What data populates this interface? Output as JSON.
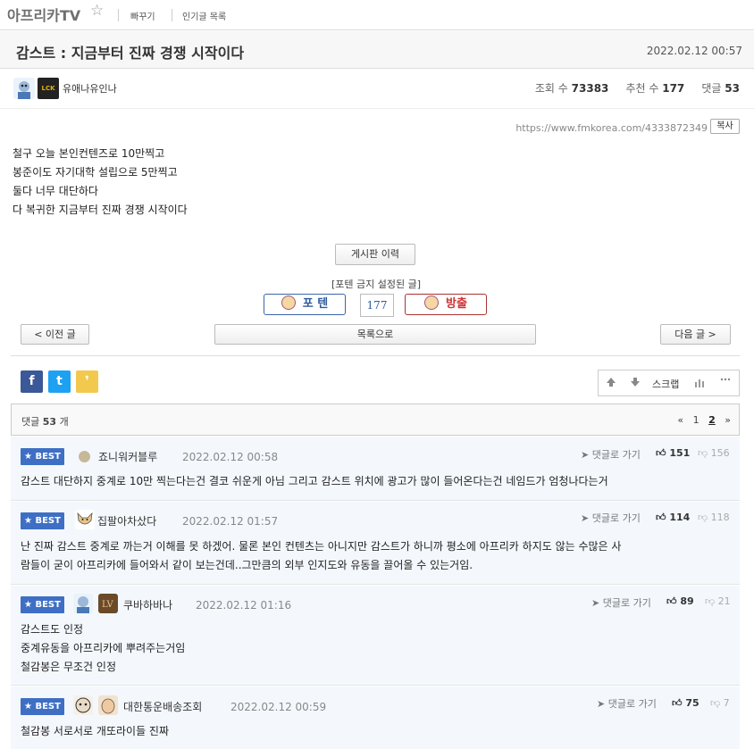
{
  "header": {
    "board_name": "아프리카TV",
    "star": "☆",
    "links": [
      "빠꾸기",
      "인기글 목록"
    ]
  },
  "post": {
    "title": "감스트 : 지금부터 진짜 경쟁 시작이다",
    "date": "2022.02.12 00:57",
    "author": "유애나유인나",
    "author_badge": "LCK",
    "views_label": "조회 수",
    "views": "73383",
    "likes_label": "추천 수",
    "likes": "177",
    "comments_label": "댓글",
    "comments": "53",
    "url": "https://www.fmkorea.com/4333872349",
    "copy_label": "복사",
    "body": [
      "철구 오늘 본인컨텐즈로 10만찍고",
      "봉준이도 자기대학 설립으로 5만찍고",
      "둘다 너무 대단하다",
      "다 복귀한 지금부터 진짜 경쟁 시작이다"
    ]
  },
  "actions": {
    "history_label": "게시판 이력",
    "poten_caption": "[포텐 금지 설정된 글]",
    "poten_label": "포 텐",
    "poten_count": "177",
    "bang_label": "방출",
    "prev_label": "< 이전 글",
    "list_label": "목록으로",
    "next_label": "다음 글 >"
  },
  "share": {
    "facebook": "f",
    "twitter": "t",
    "kakao": "❜",
    "scrap_label": "스크랩"
  },
  "comments_bar": {
    "label": "댓글",
    "count": "53",
    "unit": "개",
    "pager_prev": "«",
    "page1": "1",
    "page2": "2",
    "pager_next": "»"
  },
  "comments": [
    {
      "best": "★ BEST",
      "name": "죠니워커블루",
      "date": "2022.02.12 00:58",
      "reply": "댓글로 가기",
      "up": "151",
      "down": "156",
      "text": [
        "감스트 대단하지 중계로 10만 찍는다는건 결코 쉬운게 아님 그리고 감스트 위치에 광고가 많이 들어온다는건 네임드가 엄청나다는거"
      ]
    },
    {
      "best": "★ BEST",
      "name": "집팔아차샀다",
      "date": "2022.02.12 01:57",
      "reply": "댓글로 가기",
      "up": "114",
      "down": "118",
      "text": [
        "난 진짜 감스트 중계로 까는거 이해를 못 하겠어. 물론 본인 컨텐츠는 아니지만 감스트가 하니까 평소에 아프리카 하지도 않는 수많은 사",
        "람들이 굳이 아프리카에 들어와서 같이 보는건데..그만큼의 외부 인지도와 유동을 끌어올 수 있는거임."
      ]
    },
    {
      "best": "★ BEST",
      "name": "쿠바하바나",
      "date": "2022.02.12 01:16",
      "reply": "댓글로 가기",
      "up": "89",
      "down": "21",
      "text": [
        "감스트도 인정",
        "중계유동을 아프리카에 뿌려주는거임",
        "철감봉은 무조건 인정"
      ]
    },
    {
      "best": "★ BEST",
      "name": "대한통운배송조회",
      "date": "2022.02.12 00:59",
      "reply": "댓글로 가기",
      "up": "75",
      "down": "7",
      "text": [
        "철감봉 서로서로 개또라이들 진짜"
      ]
    }
  ],
  "colors": {
    "best": "#3e6fc4",
    "facebook": "#3b5998",
    "twitter": "#1da1f2",
    "kakao": "#f2c94c",
    "poten": "#2f5b9e",
    "bang": "#cc3333"
  }
}
